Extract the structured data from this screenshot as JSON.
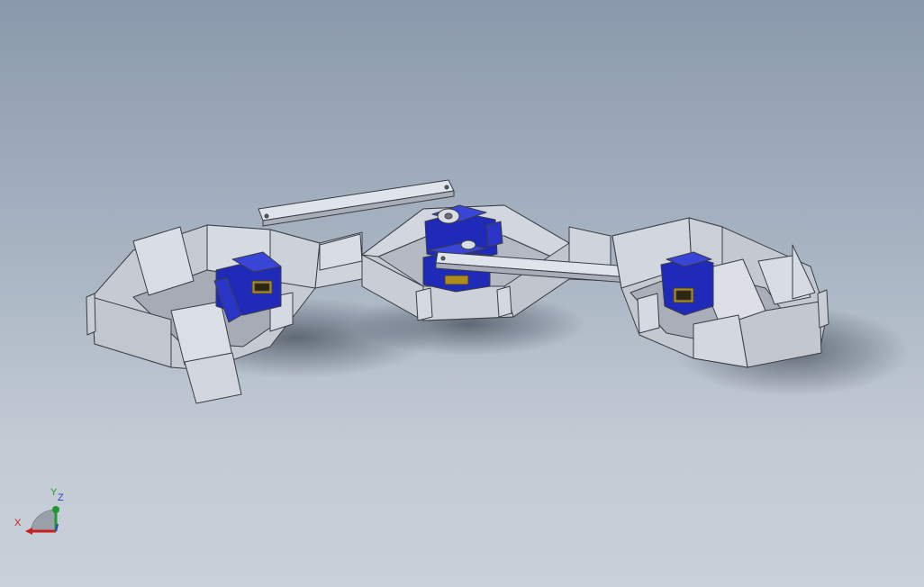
{
  "viewport": {
    "background_top": "#8a99ab",
    "background_bottom": "#c9d0d9"
  },
  "model": {
    "sheet_color": "#d4d8e0",
    "edge_color": "#3a3d44",
    "servo_color": "#1f2ab8",
    "servo_label_color": "#b08a1a"
  },
  "triad": {
    "x_label": "X",
    "y_label": "Y",
    "z_label": "Z",
    "x_color": "#c81e1e",
    "y_color": "#1f9a2e",
    "z_color": "#2a3fc0"
  }
}
